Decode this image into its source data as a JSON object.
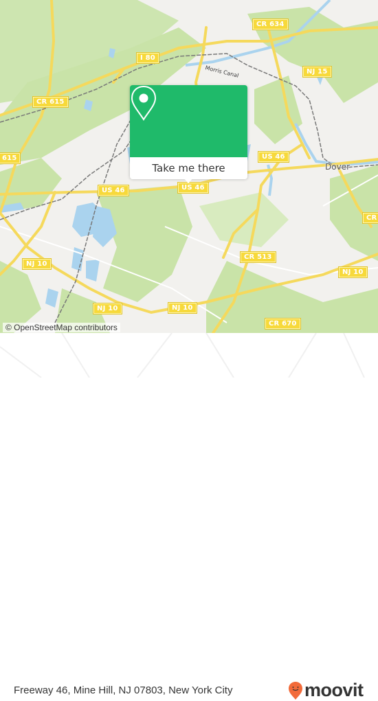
{
  "map": {
    "colors": {
      "land": "#f2f1ee",
      "forest": "#c9e3a8",
      "water": "#aad3ee",
      "road": "#f5d95c",
      "rail": "#777777"
    },
    "shields": [
      {
        "label": "CR 634"
      },
      {
        "label": "I 80"
      },
      {
        "label": "NJ 15"
      },
      {
        "label": "CR 615"
      },
      {
        "label": "615"
      },
      {
        "label": "US 46"
      },
      {
        "label": "US 46"
      },
      {
        "label": "US 46"
      },
      {
        "label": "NJ 10"
      },
      {
        "label": "NJ 10"
      },
      {
        "label": "NJ 10"
      },
      {
        "label": "NJ 10"
      },
      {
        "label": "CR 513"
      },
      {
        "label": "CR 670"
      },
      {
        "label": "CR"
      }
    ],
    "places": {
      "dover": "Dover",
      "morris_canal": "Morris Canal"
    },
    "attribution": "© OpenStreetMap contributors"
  },
  "popup": {
    "icon": "map-pin-icon",
    "button_label": "Take me there",
    "accent": "#1fba6a"
  },
  "footer": {
    "address": "Freeway 46, Mine Hill, NJ 07803, New York City",
    "brand": "moovit",
    "brand_icon": "moovit-pin-icon",
    "brand_color": "#f26b3a"
  }
}
